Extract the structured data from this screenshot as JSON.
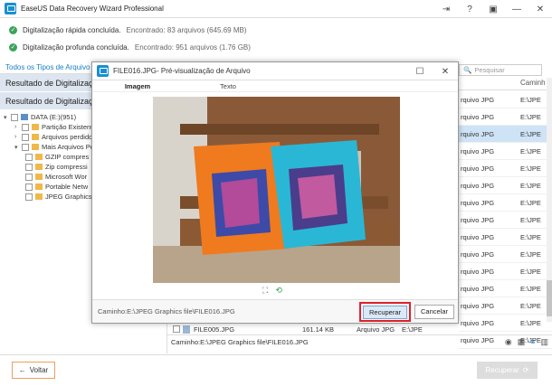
{
  "app": {
    "title": "EaseUS Data Recovery Wizard Professional"
  },
  "status": [
    {
      "label": "Digitalização rápida concluída.",
      "value": "Encontrado: 83 arquivos (645.69 MB)"
    },
    {
      "label": "Digitalização profunda concluída.",
      "value": "Encontrado: 951 arquivos (1.76 GB)"
    }
  ],
  "left": {
    "tab": "Todos os Tipos de Arquivo",
    "result1": "Resultado de Digitalização",
    "result2": "Resultado de Digitalização",
    "tree": [
      {
        "label": "DATA (E:)(951)",
        "indent": 0
      },
      {
        "label": "Partição Existente(F",
        "indent": 1
      },
      {
        "label": "Arquivos perdidos e",
        "indent": 1
      },
      {
        "label": "Mais Arquivos Perd",
        "indent": 1
      },
      {
        "label": "GZIP compres",
        "indent": 2
      },
      {
        "label": "Zip compressi",
        "indent": 2
      },
      {
        "label": "Microsoft Wor",
        "indent": 2
      },
      {
        "label": "Portable Netw",
        "indent": 2
      },
      {
        "label": "JPEG Graphics",
        "indent": 2
      }
    ]
  },
  "right": {
    "search_placeholder": "Pesquisar",
    "col_path": "Caminh",
    "rows": [
      {
        "type": "rquivo JPG",
        "path": "E:\\JPE"
      },
      {
        "type": "rquivo JPG",
        "path": "E:\\JPE"
      },
      {
        "type": "rquivo JPG",
        "path": "E:\\JPE"
      },
      {
        "type": "rquivo JPG",
        "path": "E:\\JPE"
      },
      {
        "type": "rquivo JPG",
        "path": "E:\\JPE"
      },
      {
        "type": "rquivo JPG",
        "path": "E:\\JPE"
      },
      {
        "type": "rquivo JPG",
        "path": "E:\\JPE"
      },
      {
        "type": "rquivo JPG",
        "path": "E:\\JPE"
      },
      {
        "type": "rquivo JPG",
        "path": "E:\\JPE"
      },
      {
        "type": "rquivo JPG",
        "path": "E:\\JPE"
      },
      {
        "type": "rquivo JPG",
        "path": "E:\\JPE"
      },
      {
        "type": "rquivo JPG",
        "path": "E:\\JPE"
      },
      {
        "type": "rquivo JPG",
        "path": "E:\\JPE"
      },
      {
        "type": "rquivo JPG",
        "path": "E:\\JPE"
      },
      {
        "type": "rquivo JPG",
        "path": "E:\\JPE"
      }
    ],
    "bottom_row": {
      "name": "FILE005.JPG",
      "size": "161.14 KB",
      "type": "Arquivo JPG",
      "path": "E:\\JPE"
    }
  },
  "bottom_path": "Caminho:E:\\JPEG Graphics file\\FILE016.JPG",
  "footer": {
    "back": "Voltar",
    "recover": "Recuperar"
  },
  "modal": {
    "title": "FILE016.JPG- Pré-visualização de Arquivo",
    "tab_image": "Imagem",
    "tab_text": "Texto",
    "path": "Caminho:E:\\JPEG Graphics file\\FILE016.JPG",
    "recover": "Recuperar",
    "cancel": "Cancelar"
  }
}
